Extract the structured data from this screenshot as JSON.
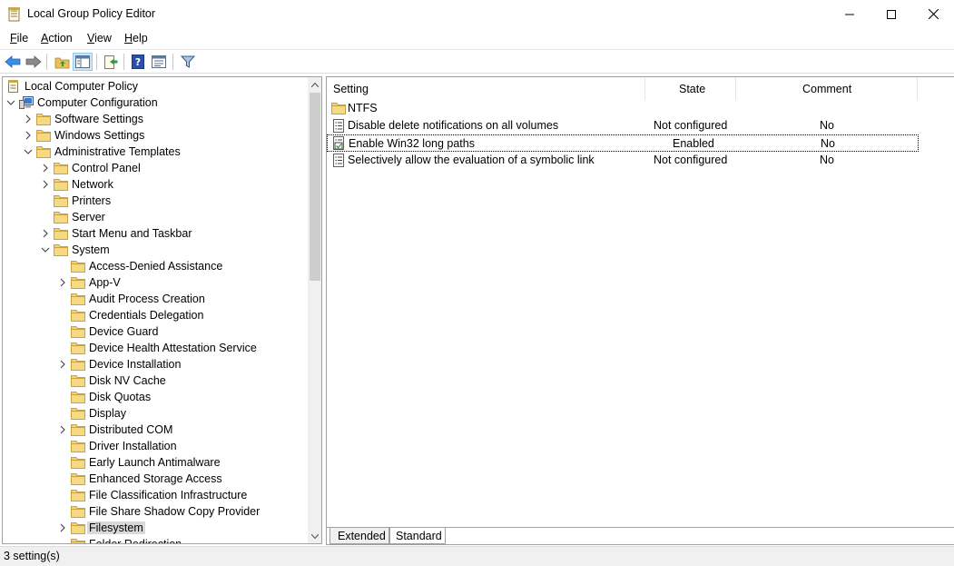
{
  "window": {
    "title": "Local Group Policy Editor",
    "minimize_glyph": "—",
    "maximize_glyph": "☐",
    "close_glyph": "✕"
  },
  "menubar": {
    "items": [
      {
        "underline": "F",
        "rest": "ile"
      },
      {
        "underline": "A",
        "rest": "ction"
      },
      {
        "underline": "V",
        "rest": "iew"
      },
      {
        "underline": "H",
        "rest": "elp"
      }
    ]
  },
  "toolbar": {
    "icons": [
      "back-arrow-icon",
      "forward-arrow-icon",
      "up-folder-icon",
      "show-hide-tree-icon",
      "export-list-icon",
      "help-icon",
      "properties-icon",
      "filter-icon"
    ]
  },
  "tree": {
    "items": [
      {
        "label": "Local Computer Policy",
        "level": 0,
        "expander": "none",
        "icon": "policy-icon"
      },
      {
        "label": "Computer Configuration",
        "level": 0,
        "expander": "expanded",
        "icon": "computer-icon"
      },
      {
        "label": "Software Settings",
        "level": 1,
        "expander": "collapsed",
        "icon": "folder-icon"
      },
      {
        "label": "Windows Settings",
        "level": 1,
        "expander": "collapsed",
        "icon": "folder-icon"
      },
      {
        "label": "Administrative Templates",
        "level": 1,
        "expander": "expanded",
        "icon": "folder-icon"
      },
      {
        "label": "Control Panel",
        "level": 2,
        "expander": "collapsed",
        "icon": "folder-icon"
      },
      {
        "label": "Network",
        "level": 2,
        "expander": "collapsed",
        "icon": "folder-icon"
      },
      {
        "label": "Printers",
        "level": 2,
        "expander": "none",
        "icon": "folder-icon"
      },
      {
        "label": "Server",
        "level": 2,
        "expander": "none",
        "icon": "folder-icon"
      },
      {
        "label": "Start Menu and Taskbar",
        "level": 2,
        "expander": "collapsed",
        "icon": "folder-icon"
      },
      {
        "label": "System",
        "level": 2,
        "expander": "expanded",
        "icon": "folder-icon"
      },
      {
        "label": "Access-Denied Assistance",
        "level": 3,
        "expander": "none",
        "icon": "folder-icon"
      },
      {
        "label": "App-V",
        "level": 3,
        "expander": "collapsed",
        "icon": "folder-icon"
      },
      {
        "label": "Audit Process Creation",
        "level": 3,
        "expander": "none",
        "icon": "folder-icon"
      },
      {
        "label": "Credentials Delegation",
        "level": 3,
        "expander": "none",
        "icon": "folder-icon"
      },
      {
        "label": "Device Guard",
        "level": 3,
        "expander": "none",
        "icon": "folder-icon"
      },
      {
        "label": "Device Health Attestation Service",
        "level": 3,
        "expander": "none",
        "icon": "folder-icon"
      },
      {
        "label": "Device Installation",
        "level": 3,
        "expander": "collapsed",
        "icon": "folder-icon"
      },
      {
        "label": "Disk NV Cache",
        "level": 3,
        "expander": "none",
        "icon": "folder-icon"
      },
      {
        "label": "Disk Quotas",
        "level": 3,
        "expander": "none",
        "icon": "folder-icon"
      },
      {
        "label": "Display",
        "level": 3,
        "expander": "none",
        "icon": "folder-icon"
      },
      {
        "label": "Distributed COM",
        "level": 3,
        "expander": "collapsed",
        "icon": "folder-icon"
      },
      {
        "label": "Driver Installation",
        "level": 3,
        "expander": "none",
        "icon": "folder-icon"
      },
      {
        "label": "Early Launch Antimalware",
        "level": 3,
        "expander": "none",
        "icon": "folder-icon"
      },
      {
        "label": "Enhanced Storage Access",
        "level": 3,
        "expander": "none",
        "icon": "folder-icon"
      },
      {
        "label": "File Classification Infrastructure",
        "level": 3,
        "expander": "none",
        "icon": "folder-icon"
      },
      {
        "label": "File Share Shadow Copy Provider",
        "level": 3,
        "expander": "none",
        "icon": "folder-icon"
      },
      {
        "label": "Filesystem",
        "level": 3,
        "expander": "collapsed",
        "icon": "folder-icon",
        "selected": true
      },
      {
        "label": "Folder Redirection",
        "level": 3,
        "expander": "none",
        "icon": "folder-icon"
      }
    ]
  },
  "list": {
    "columns": {
      "setting": "Setting",
      "state": "State",
      "comment": "Comment"
    },
    "folder": {
      "label": "NTFS",
      "icon": "folder-icon"
    },
    "rows": [
      {
        "setting": "Disable delete notifications on all volumes",
        "state": "Not configured",
        "comment": "No",
        "icon": "policy-setting-icon"
      },
      {
        "setting": "Enable Win32 long paths",
        "state": "Enabled",
        "comment": "No",
        "icon": "policy-setting-enabled-icon",
        "focused": true
      },
      {
        "setting": "Selectively allow the evaluation of a symbolic link",
        "state": "Not configured",
        "comment": "No",
        "icon": "policy-setting-icon"
      }
    ]
  },
  "tabs": {
    "extended": "Extended",
    "standard": "Standard",
    "active": "standard"
  },
  "status": {
    "text": "3 setting(s)"
  },
  "colors": {
    "folder": "#e8c05a",
    "selection": "#d9d9d9",
    "accent": "#1a6fc4"
  }
}
